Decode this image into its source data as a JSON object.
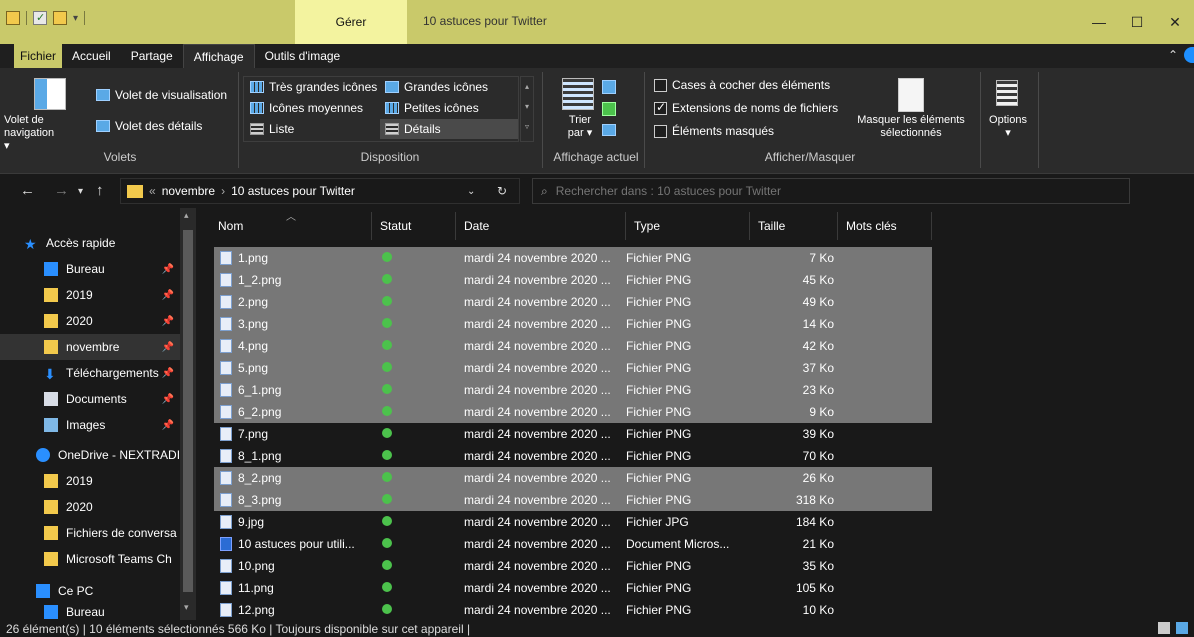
{
  "titlebar": {
    "manage_tab": "Gérer",
    "title": "10 astuces pour Twitter",
    "minimize": "—",
    "maximize": "☐",
    "close": "✕"
  },
  "tabs": [
    {
      "label": "Fichier"
    },
    {
      "label": "Accueil"
    },
    {
      "label": "Partage"
    },
    {
      "label": "Affichage"
    },
    {
      "label": "Outils d'image"
    }
  ],
  "ribbon": {
    "volets": {
      "nav_pane": "Volet de navigation ▾",
      "preview": "Volet de visualisation",
      "details": "Volet des détails",
      "label": "Volets"
    },
    "layout": {
      "very_large": "Très grandes icônes",
      "large": "Grandes icônes",
      "medium": "Icônes moyennes",
      "small": "Petites icônes",
      "list": "Liste",
      "details": "Détails",
      "label": "Disposition"
    },
    "current_view": {
      "sort": "Trier par ▾",
      "label": "Affichage actuel"
    },
    "show_hide": {
      "checkboxes": "Cases à cocher des éléments",
      "extensions": "Extensions de noms de fichiers",
      "hidden": "Éléments masqués",
      "hide_selected": "Masquer les éléments sélectionnés",
      "label": "Afficher/Masquer"
    },
    "options": "Options"
  },
  "address": {
    "overflow": "«",
    "crumb1": "novembre",
    "crumb2": "10 astuces pour Twitter",
    "search_placeholder": "Rechercher dans : 10 astuces pour Twitter"
  },
  "nav": [
    {
      "label": "Accès rapide",
      "icon": "star-icon",
      "pinned": false
    },
    {
      "label": "Bureau",
      "icon": "desktop-icon",
      "pinned": true
    },
    {
      "label": "2019",
      "icon": "folder-icon",
      "pinned": true
    },
    {
      "label": "2020",
      "icon": "folder-icon",
      "pinned": true
    },
    {
      "label": "novembre",
      "icon": "folder-icon",
      "pinned": true
    },
    {
      "label": "Téléchargements",
      "icon": "download-icon",
      "pinned": true
    },
    {
      "label": "Documents",
      "icon": "documents-icon",
      "pinned": true
    },
    {
      "label": "Images",
      "icon": "images-icon",
      "pinned": true
    },
    {
      "label": "OneDrive - NEXTRADI",
      "icon": "cloud-icon",
      "pinned": false
    },
    {
      "label": "2019",
      "icon": "folder-icon",
      "pinned": false
    },
    {
      "label": "2020",
      "icon": "folder-icon",
      "pinned": false
    },
    {
      "label": "Fichiers de conversa",
      "icon": "folder-icon",
      "pinned": false
    },
    {
      "label": "Microsoft Teams Ch",
      "icon": "folder-icon",
      "pinned": false
    },
    {
      "label": "Ce PC",
      "icon": "pc-icon",
      "pinned": false
    },
    {
      "label": "Bureau",
      "icon": "desktop-icon",
      "pinned": false
    }
  ],
  "columns": {
    "name": "Nom",
    "status": "Statut",
    "date": "Date",
    "type": "Type",
    "size": "Taille",
    "tags": "Mots clés"
  },
  "files": [
    {
      "name": "1.png",
      "date": "mardi 24 novembre 2020 ...",
      "type": "Fichier PNG",
      "size": "7 Ko",
      "selected": true,
      "kind": "png"
    },
    {
      "name": "1_2.png",
      "date": "mardi 24 novembre 2020 ...",
      "type": "Fichier PNG",
      "size": "45 Ko",
      "selected": true,
      "kind": "png"
    },
    {
      "name": "2.png",
      "date": "mardi 24 novembre 2020 ...",
      "type": "Fichier PNG",
      "size": "49 Ko",
      "selected": true,
      "kind": "png"
    },
    {
      "name": "3.png",
      "date": "mardi 24 novembre 2020 ...",
      "type": "Fichier PNG",
      "size": "14 Ko",
      "selected": true,
      "kind": "png"
    },
    {
      "name": "4.png",
      "date": "mardi 24 novembre 2020 ...",
      "type": "Fichier PNG",
      "size": "42 Ko",
      "selected": true,
      "kind": "png"
    },
    {
      "name": "5.png",
      "date": "mardi 24 novembre 2020 ...",
      "type": "Fichier PNG",
      "size": "37 Ko",
      "selected": true,
      "kind": "png"
    },
    {
      "name": "6_1.png",
      "date": "mardi 24 novembre 2020 ...",
      "type": "Fichier PNG",
      "size": "23 Ko",
      "selected": true,
      "kind": "png"
    },
    {
      "name": "6_2.png",
      "date": "mardi 24 novembre 2020 ...",
      "type": "Fichier PNG",
      "size": "9 Ko",
      "selected": true,
      "kind": "png"
    },
    {
      "name": "7.png",
      "date": "mardi 24 novembre 2020 ...",
      "type": "Fichier PNG",
      "size": "39 Ko",
      "selected": false,
      "kind": "png"
    },
    {
      "name": "8_1.png",
      "date": "mardi 24 novembre 2020 ...",
      "type": "Fichier PNG",
      "size": "70 Ko",
      "selected": false,
      "kind": "png"
    },
    {
      "name": "8_2.png",
      "date": "mardi 24 novembre 2020 ...",
      "type": "Fichier PNG",
      "size": "26 Ko",
      "selected": true,
      "kind": "png"
    },
    {
      "name": "8_3.png",
      "date": "mardi 24 novembre 2020 ...",
      "type": "Fichier PNG",
      "size": "318 Ko",
      "selected": true,
      "kind": "png"
    },
    {
      "name": "9.jpg",
      "date": "mardi 24 novembre 2020 ...",
      "type": "Fichier JPG",
      "size": "184 Ko",
      "selected": false,
      "kind": "jpg"
    },
    {
      "name": "10 astuces pour utili...",
      "date": "mardi 24 novembre 2020 ...",
      "type": "Document Micros...",
      "size": "21 Ko",
      "selected": false,
      "kind": "word"
    },
    {
      "name": "10.png",
      "date": "mardi 24 novembre 2020 ...",
      "type": "Fichier PNG",
      "size": "35 Ko",
      "selected": false,
      "kind": "png"
    },
    {
      "name": "11.png",
      "date": "mardi 24 novembre 2020 ...",
      "type": "Fichier PNG",
      "size": "105 Ko",
      "selected": false,
      "kind": "png"
    },
    {
      "name": "12.png",
      "date": "mardi 24 novembre 2020 ...",
      "type": "Fichier PNG",
      "size": "10 Ko",
      "selected": false,
      "kind": "png"
    }
  ],
  "status": {
    "text": "26 élément(s)  |  10 éléments sélectionnés  566 Ko  |  Toujours disponible sur cet appareil  |"
  },
  "colors": {
    "accent": "#c9c96a",
    "selection": "#777777",
    "status_ok": "#4cc24c"
  }
}
